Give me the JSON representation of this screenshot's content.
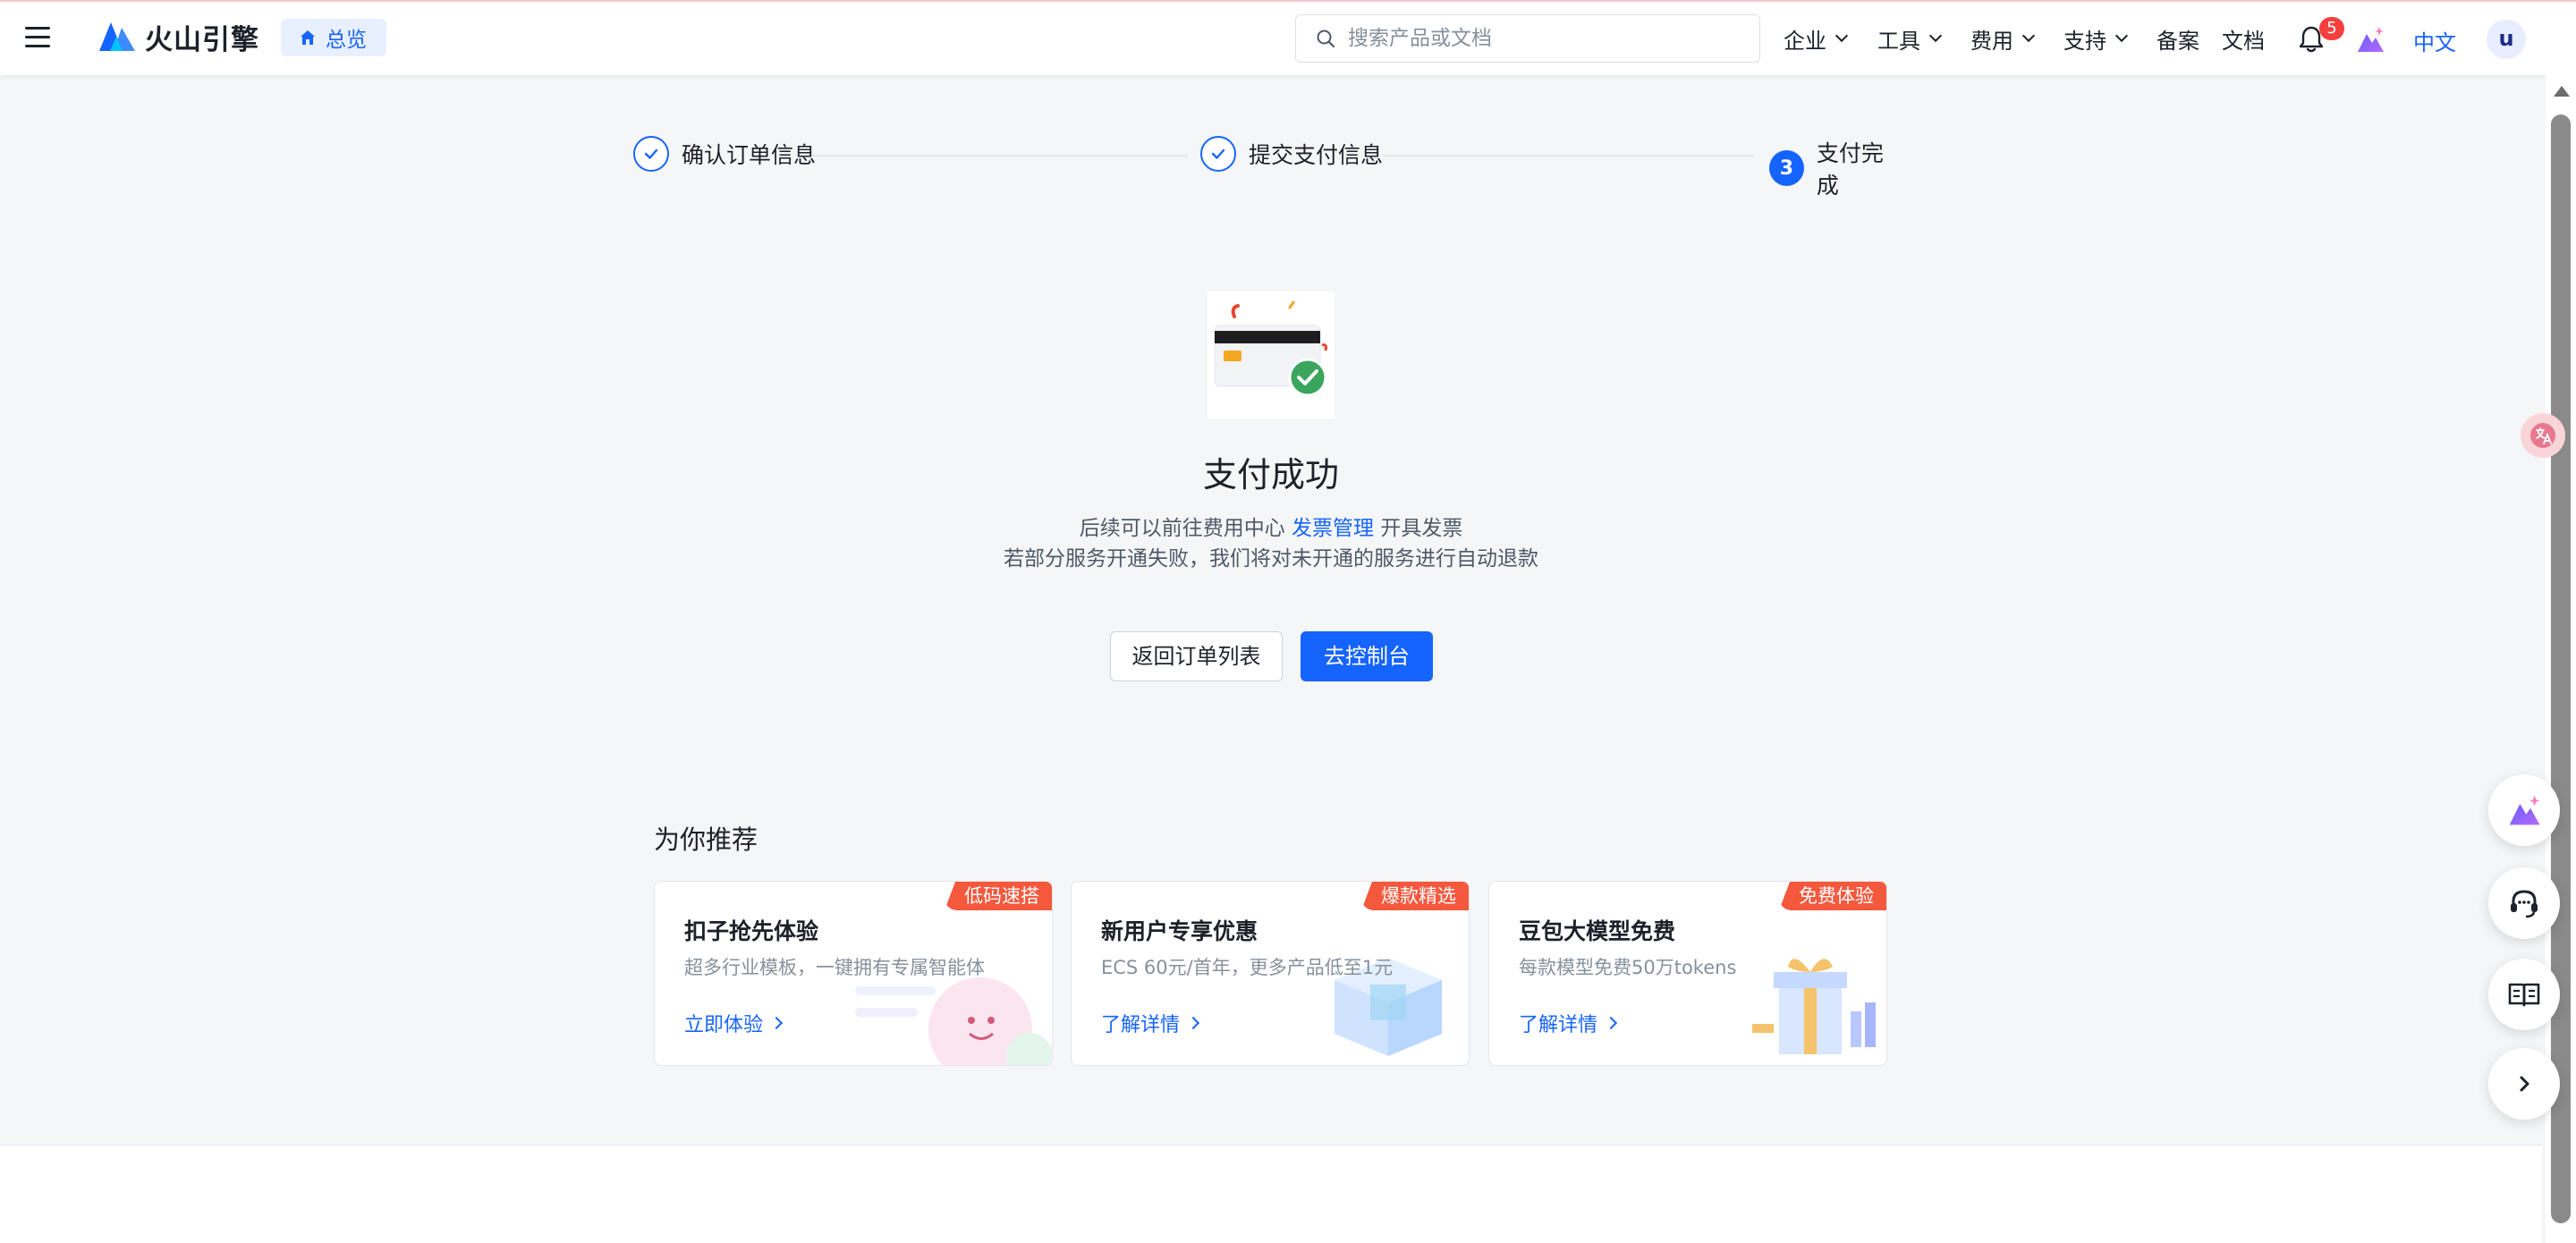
{
  "header": {
    "logo_text": "火山引擎",
    "overview_label": "总览",
    "search_placeholder": "搜索产品或文档",
    "nav": [
      {
        "label": "企业"
      },
      {
        "label": "工具"
      },
      {
        "label": "费用"
      },
      {
        "label": "支持"
      },
      {
        "label": "备案"
      },
      {
        "label": "文档"
      }
    ],
    "notification_count": "5",
    "language": "中文",
    "avatar_letter": "u"
  },
  "steps": [
    {
      "label": "确认订单信息",
      "state": "done"
    },
    {
      "label": "提交支付信息",
      "state": "done"
    },
    {
      "label": "支付完成",
      "state": "current",
      "index": "3"
    }
  ],
  "result": {
    "title": "支付成功",
    "desc_prefix": "后续可以前往费用中心",
    "desc_link": "发票管理",
    "desc_suffix": "开具发票",
    "desc_line2": "若部分服务开通失败，我们将对未开通的服务进行自动退款",
    "back_button": "返回订单列表",
    "console_button": "去控制台"
  },
  "recommend": {
    "title": "为你推荐",
    "cards": [
      {
        "tag": "低码速搭",
        "title": "扣子抢先体验",
        "desc": "超多行业模板，一键拥有专属智能体",
        "link": "立即体验"
      },
      {
        "tag": "爆款精选",
        "title": "新用户专享优惠",
        "desc": "ECS 60元/首年，更多产品低至1元",
        "link": "了解详情"
      },
      {
        "tag": "免费体验",
        "title": "豆包大模型免费",
        "desc": "每款模型免费50万tokens",
        "link": "了解详情"
      }
    ]
  },
  "colors": {
    "accent": "#1664ff",
    "tag": "#f4583d",
    "badge": "#f53f3f",
    "success": "#3aa55d"
  }
}
